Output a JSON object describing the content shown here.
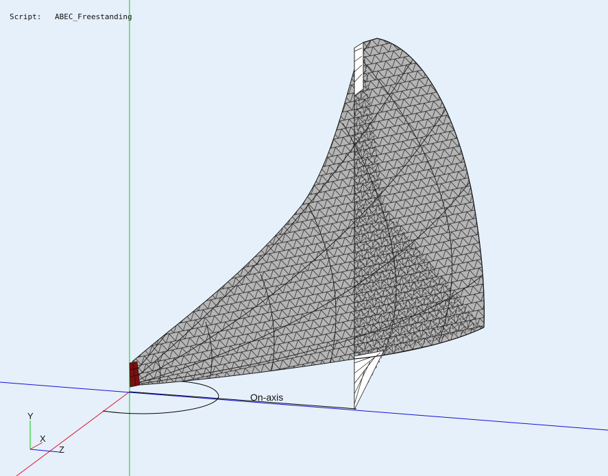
{
  "header": {
    "script_label": "Script:",
    "script_name": "ABEC_Freestanding"
  },
  "scene": {
    "on_axis_label": "On-axis",
    "triad": {
      "y_label": "Y",
      "x_label": "X",
      "z_label": "Z"
    }
  },
  "colors": {
    "background": "#e6f0fb",
    "mesh_fill": "#b5b5b5",
    "mesh_line": "#1a1a1a",
    "y_axis": "#00d000",
    "x_axis": "#e01020",
    "z_axis": "#1010d0",
    "driver": "#7a1010"
  }
}
